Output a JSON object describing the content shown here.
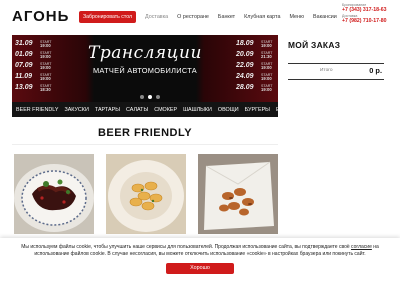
{
  "header": {
    "logo": "АГОНЬ",
    "reserve_label": "Забронировать стол",
    "nav": [
      "Доставка",
      "О ресторане",
      "Банкет",
      "Клубная карта",
      "Меню",
      "Вакансии"
    ],
    "booking_label": "Бронирование",
    "booking_phone": "+7 (343) 317-18-63",
    "delivery_label": "Доставка",
    "delivery_phone": "+7 (982) 710-17-80"
  },
  "banner": {
    "title": "Трансляции",
    "subtitle": "МАТЧЕЙ АВТОМОБИЛИСТА",
    "start_label": "START",
    "left_schedule": [
      {
        "date": "31.09",
        "time": "19:00"
      },
      {
        "date": "01.09",
        "time": "19:00"
      },
      {
        "date": "07.09",
        "time": "19:00"
      },
      {
        "date": "11.09",
        "time": "19:00"
      },
      {
        "date": "13.09",
        "time": "18:30"
      }
    ],
    "right_schedule": [
      {
        "date": "18.09",
        "time": "19:00"
      },
      {
        "date": "20.09",
        "time": "21:30"
      },
      {
        "date": "22.09",
        "time": "19:00"
      },
      {
        "date": "24.09",
        "time": "19:00"
      },
      {
        "date": "28.09",
        "time": "19:00"
      }
    ],
    "slides": 3,
    "active_slide": 1
  },
  "categories": [
    "BEER FRIENDLY",
    "ЗАКУСКИ",
    "ТАРТАРЫ",
    "САЛАТЫ",
    "СМОКЕР",
    "ШАШЛЫКИ",
    "ОВОЩИ",
    "БУРГЕРЫ",
    "Еще"
  ],
  "section_title": "BEER FRIENDLY",
  "products": [
    {
      "icon": "ribs-dish-image"
    },
    {
      "icon": "pasta-dish-image"
    },
    {
      "icon": "nuts-dish-image"
    }
  ],
  "order": {
    "title": "МОЙ ЗАКАЗ",
    "total_label": "Итого",
    "total_value": "0 р."
  },
  "cookie": {
    "text_before": "Мы используем файлы cookie, чтобы улучшить наше сервисы для пользователей. Продолжая использование сайта, вы подтверждаете своё ",
    "link": "согласие",
    "text_after": " на использование файлов cookie. В случае несогласия, вы можете отключить использование «cookie» в настройках браузера или покинуть сайт.",
    "button": "Хорошо"
  },
  "colors": {
    "accent": "#d01b1b",
    "dark": "#141414"
  }
}
